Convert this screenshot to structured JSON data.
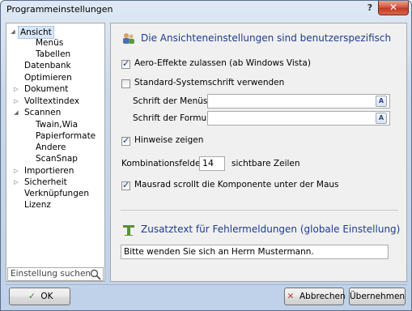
{
  "window": {
    "title": "Programmeinstellungen",
    "help_glyph": "?",
    "close_glyph": "✕"
  },
  "tree": {
    "items": [
      {
        "label": "Ansicht",
        "expander": "◢",
        "selected": true
      },
      {
        "label": "Menüs"
      },
      {
        "label": "Tabellen"
      },
      {
        "label": "Datenbank"
      },
      {
        "label": "Optimieren"
      },
      {
        "label": "Dokument",
        "expander": "▷"
      },
      {
        "label": "Volltextindex",
        "expander": "▷"
      },
      {
        "label": "Scannen",
        "expander": "◢"
      },
      {
        "label": "Twain,Wia"
      },
      {
        "label": "Papierformate"
      },
      {
        "label": "Andere"
      },
      {
        "label": "ScanSnap"
      },
      {
        "label": "Importieren",
        "expander": "▷"
      },
      {
        "label": "Sicherheit",
        "expander": "▷"
      },
      {
        "label": "Verknüpfungen"
      },
      {
        "label": "Lizenz"
      }
    ],
    "search_placeholder": "Einstellung suchen"
  },
  "panel": {
    "heading": "Die Ansichteneinstellungen sind benutzerspezifisch",
    "aero": {
      "label": "Aero-Effekte zulassen (ab Windows Vista)",
      "checked": true
    },
    "system_font": {
      "label": "Standard-Systemschrift verwenden",
      "checked": false
    },
    "menu_font": {
      "label": "Schrift der Menüs",
      "value": ""
    },
    "form_font": {
      "label": "Schrift der Formulare",
      "value": ""
    },
    "hints": {
      "label": "Hinweise zeigen",
      "checked": true
    },
    "combo": {
      "label": "Kombinationsfelder",
      "value": "14",
      "suffix": "sichtbare Zeilen"
    },
    "mousewheel": {
      "label": "Mausrad scrollt die Komponente unter der Maus",
      "checked": true
    },
    "error_heading": "Zusatztext für Fehlermeldungen (globale Einstellung)",
    "error_text": "Bitte wenden Sie sich an Herrn Mustermann."
  },
  "footer": {
    "ok": "OK",
    "cancel": "Abbrechen",
    "apply": "Übernehmen"
  },
  "colors": {
    "heading": "#1e3c8c",
    "window_border": "#5a6e8a",
    "close_red": "#c23a22"
  }
}
